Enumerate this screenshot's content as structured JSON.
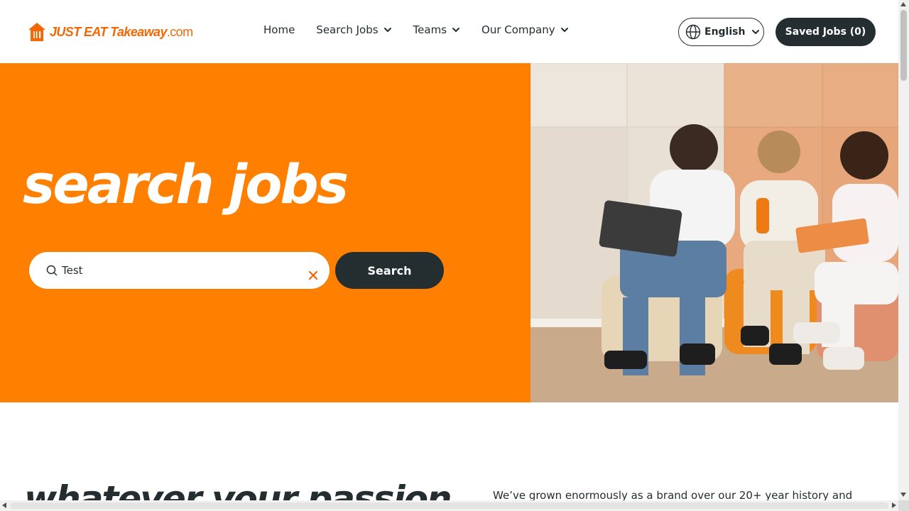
{
  "brand": {
    "logo_text": "JUST EAT Takeaway",
    "logo_suffix": ".com",
    "color": "#f36805"
  },
  "nav": {
    "items": [
      {
        "label": "Home",
        "has_dropdown": false
      },
      {
        "label": "Search Jobs",
        "has_dropdown": true
      },
      {
        "label": "Teams",
        "has_dropdown": true
      },
      {
        "label": "Our Company",
        "has_dropdown": true
      }
    ]
  },
  "header": {
    "language_label": "English",
    "saved_jobs_label": "Saved Jobs",
    "saved_jobs_count": "(0)"
  },
  "hero": {
    "title": "search jobs",
    "background": "#ff8000",
    "search": {
      "value": "Test",
      "icon": "search-icon",
      "clear_icon": "close-icon"
    },
    "search_button_label": "Search",
    "image_icon": "photo-of-three-people-chatting"
  },
  "intro": {
    "title": "whatever your passion",
    "text": "We’ve grown enormously as a brand over our 20+ year history and"
  },
  "colors": {
    "dark": "#242e30",
    "accent": "#ff8000"
  }
}
